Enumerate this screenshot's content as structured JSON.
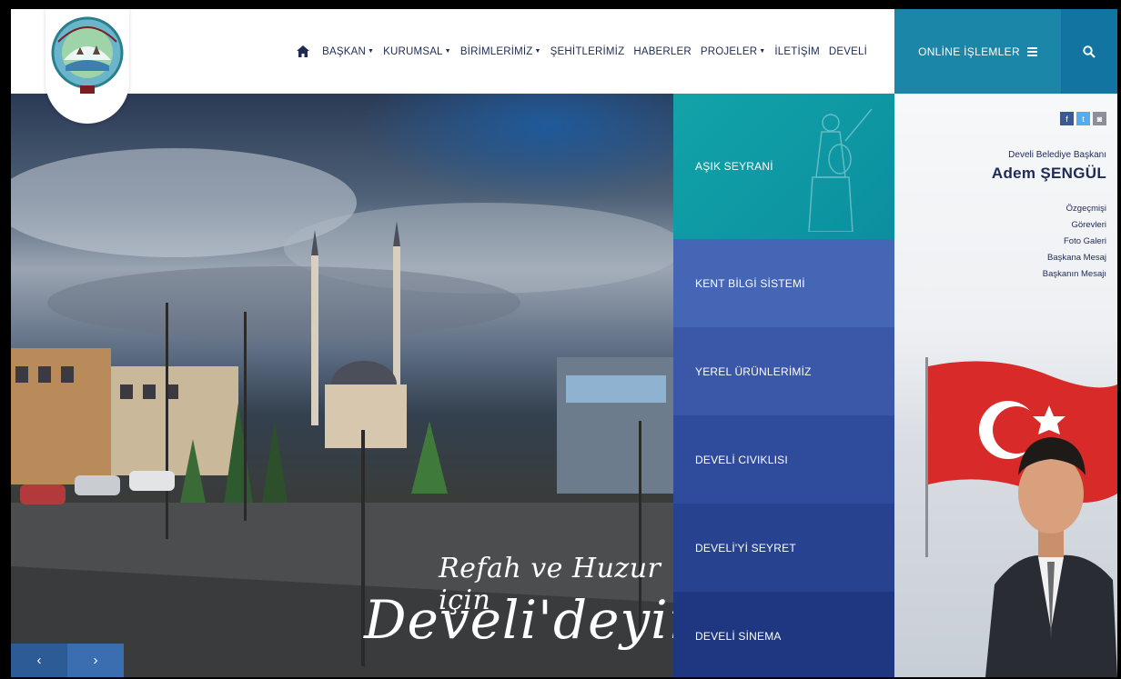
{
  "header": {
    "nav": [
      {
        "label": "BAŞKAN",
        "dropdown": true
      },
      {
        "label": "KURUMSAL",
        "dropdown": true
      },
      {
        "label": "BİRİMLERİMİZ",
        "dropdown": true
      },
      {
        "label": "ŞEHİTLERİMİZ",
        "dropdown": false
      },
      {
        "label": "HABERLER",
        "dropdown": false
      },
      {
        "label": "PROJELER",
        "dropdown": true
      },
      {
        "label": "İLETİŞİM",
        "dropdown": false
      },
      {
        "label": "DEVELİ",
        "dropdown": false
      }
    ],
    "online_label": "ONLİNE İŞLEMLER"
  },
  "logo": {
    "text_top": "DEVELİ BELEDİYESİ",
    "year": "1871"
  },
  "hero": {
    "line1": "Refah ve Huzur için",
    "line2": "Develi'deyim",
    "prev": "‹",
    "next": "›"
  },
  "tiles": [
    {
      "label": "AŞIK SEYRANİ"
    },
    {
      "label": "KENT BİLGİ SİSTEMİ"
    },
    {
      "label": "YEREL ÜRÜNLERİMİZ"
    },
    {
      "label": "DEVELİ CIVIKLISI"
    },
    {
      "label": "DEVELİ'Yİ SEYRET"
    },
    {
      "label": "DEVELİ SİNEMA"
    }
  ],
  "panel": {
    "social": [
      "f",
      "t",
      "◙"
    ],
    "mayor_title": "Develi Belediye Başkanı",
    "mayor_name": "Adem ŞENGÜL",
    "links": [
      "Özgeçmişi",
      "Görevleri",
      "Foto Galeri",
      "Başkana Mesaj",
      "Başkanın Mesajı"
    ]
  },
  "colors": {
    "nav_text": "#1f2a55",
    "online_bg": "#1b86a7",
    "search_bg": "#1274a0",
    "tile_first": "#12a3a8",
    "flag_red": "#d92a2a"
  }
}
